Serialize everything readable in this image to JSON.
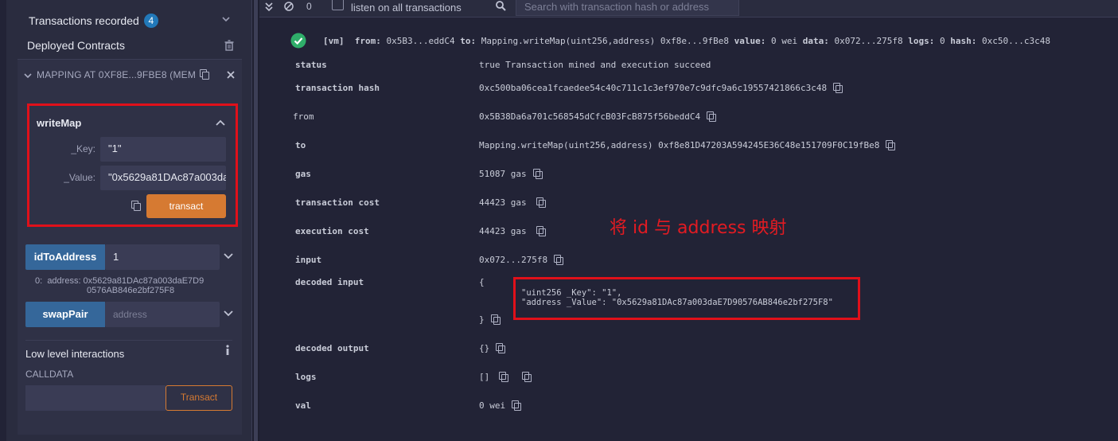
{
  "sidebar": {
    "transactions_label": "Transactions recorded",
    "transactions_count": "4",
    "deployed_label": "Deployed Contracts",
    "contract_label": "MAPPING AT 0XF8E...9FBE8 (MEM",
    "writeMap": {
      "title": "writeMap",
      "key_label": "_Key:",
      "key_value": "\"1\"",
      "value_label": "_Value:",
      "value_value": "\"0x5629a81DAc87a003daE7D90576AB846e2bf275F8\"",
      "transact_label": "transact"
    },
    "idToAddress": {
      "label": "idToAddress",
      "input_value": "1",
      "result_index": "0:",
      "result_line1": "address: 0x5629a81DAc87a003daE7D9",
      "result_line2": "0576AB846e2bf275F8"
    },
    "swapPair": {
      "label": "swapPair",
      "placeholder": "address"
    },
    "low_level_label": "Low level interactions",
    "calldata_label": "CALLDATA",
    "calldata_transact_label": "Transact"
  },
  "toolbar": {
    "count": "0",
    "listen_label": "listen on all transactions",
    "search_placeholder": "Search with transaction hash or address"
  },
  "tx": {
    "summary": {
      "vm": "[vm]",
      "from_label": "from:",
      "from_value": "0x5B3...eddC4",
      "to_label": "to:",
      "to_value": "Mapping.writeMap(uint256,address) 0xf8e...9fBe8",
      "value_label": "value:",
      "value_value": "0 wei",
      "data_label": "data:",
      "data_value": "0x072...275f8",
      "logs_label": "logs:",
      "logs_value": "0",
      "hash_label": "hash:",
      "hash_value": "0xc50...c3c48"
    },
    "rows": [
      {
        "key": "status",
        "value": "true Transaction mined and execution succeed"
      },
      {
        "key": "transaction hash",
        "value": "0xc500ba06cea1fcaedee54c40c711c1c3ef970e7c9dfc9a6c19557421866c3c48"
      },
      {
        "key": "from",
        "value": "0x5B38Da6a701c568545dCfcB03FcB875f56beddC4"
      },
      {
        "key": "to",
        "value": "Mapping.writeMap(uint256,address) 0xf8e81D47203A594245E36C48e151709F0C19fBe8"
      },
      {
        "key": "gas",
        "value": "51087 gas"
      },
      {
        "key": "transaction cost",
        "value": "44423 gas"
      },
      {
        "key": "execution cost",
        "value": "44423 gas"
      },
      {
        "key": "input",
        "value": "0x072...275f8"
      },
      {
        "key": "decoded input",
        "value": "{"
      },
      {
        "key": "decoded output",
        "value": "{}"
      },
      {
        "key": "logs",
        "value": "[]"
      },
      {
        "key": "val",
        "value": "0 wei"
      }
    ],
    "decoded_input_line1": "\"uint256 _Key\": \"1\",",
    "decoded_input_line2": "\"address _Value\": \"0x5629a81DAc87a003daE7D90576AB846e2bf275F8\"",
    "decoded_input_close": "}"
  },
  "annotation": "将 id 与 address 映射",
  "colors": {
    "accent_orange": "#d67a32",
    "button_blue": "#35679a",
    "highlight_red": "#e0101a",
    "success_green": "#2fae6a"
  }
}
